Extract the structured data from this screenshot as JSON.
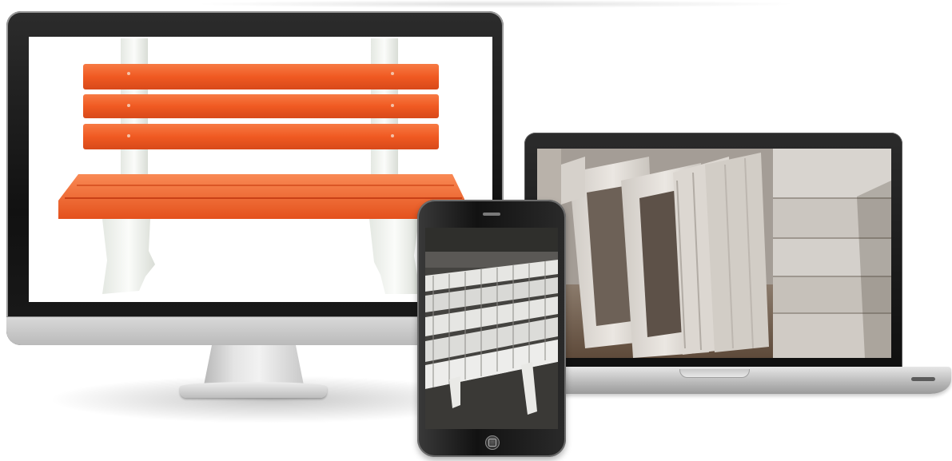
{
  "colors": {
    "bench_orange": "#f05a22",
    "bench_white": "#f3f5f0",
    "concrete": "#d8d4cf",
    "device_black": "#151515",
    "device_silver": "#c9c9c9"
  },
  "devices": {
    "monitor": {
      "content": "orange-bench-photo"
    },
    "laptop": {
      "content": "concrete-frames-photo"
    },
    "tablet": {
      "content": "concrete-products-photo"
    }
  }
}
